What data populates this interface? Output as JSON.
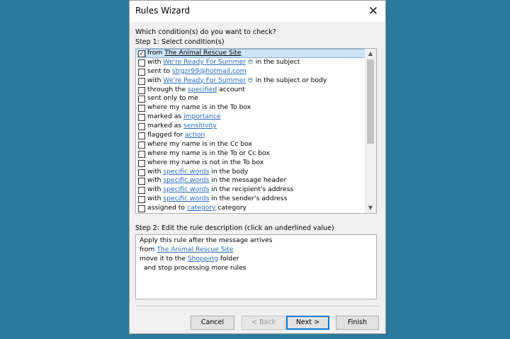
{
  "window": {
    "title": "Rules Wizard",
    "close_glyph": "✕"
  },
  "question": "Which condition(s) do you want to check?",
  "step1_label": "Step 1: Select condition(s)",
  "conditions": [
    {
      "pre": "from ",
      "link": "The Animal Rescue Site",
      "post": "",
      "checked": true
    },
    {
      "pre": "with ",
      "link": "We're Ready For Summer",
      "emoji": "😎",
      "post": " in the subject",
      "checked": false
    },
    {
      "pre": "sent to ",
      "link": "strgzr99@hotmail.com",
      "post": "",
      "checked": false
    },
    {
      "pre": "with ",
      "link": "We're Ready For Summer",
      "emoji": "😎",
      "post": " in the subject or body",
      "checked": false
    },
    {
      "pre": "through the ",
      "link": "specified",
      "post": " account",
      "checked": false
    },
    {
      "pre": "sent only to me",
      "link": "",
      "post": "",
      "checked": false
    },
    {
      "pre": "where my name is in the To box",
      "link": "",
      "post": "",
      "checked": false
    },
    {
      "pre": "marked as ",
      "link": "importance",
      "post": "",
      "checked": false
    },
    {
      "pre": "marked as ",
      "link": "sensitivity",
      "post": "",
      "checked": false
    },
    {
      "pre": "flagged for ",
      "link": "action",
      "post": "",
      "checked": false
    },
    {
      "pre": "where my name is in the Cc box",
      "link": "",
      "post": "",
      "checked": false
    },
    {
      "pre": "where my name is in the To or Cc box",
      "link": "",
      "post": "",
      "checked": false
    },
    {
      "pre": "where my name is not in the To box",
      "link": "",
      "post": "",
      "checked": false
    },
    {
      "pre": "with ",
      "link": "specific words",
      "post": " in the body",
      "checked": false
    },
    {
      "pre": "with ",
      "link": "specific words",
      "post": " in the message header",
      "checked": false
    },
    {
      "pre": "with ",
      "link": "specific words",
      "post": " in the recipient's address",
      "checked": false
    },
    {
      "pre": "with ",
      "link": "specific words",
      "post": " in the sender's address",
      "checked": false
    },
    {
      "pre": "assigned to ",
      "link": "category",
      "post": " category",
      "checked": false
    }
  ],
  "step2_label": "Step 2: Edit the rule description (click an underlined value)",
  "description": {
    "line1": "Apply this rule after the message arrives",
    "line2_pre": "from ",
    "line2_link": "The Animal Rescue Site",
    "line3_pre": "move it to the ",
    "line3_link": "Shopping",
    "line3_post": " folder",
    "line4": "  and stop processing more rules"
  },
  "buttons": {
    "cancel": "Cancel",
    "back": "< Back",
    "next": "Next >",
    "finish": "Finish"
  },
  "scroll": {
    "up": "▲",
    "down": "▼"
  },
  "colors": {
    "background": "#2b7a9a",
    "link": "#2a6dc0",
    "selection": "#cce4f7"
  }
}
